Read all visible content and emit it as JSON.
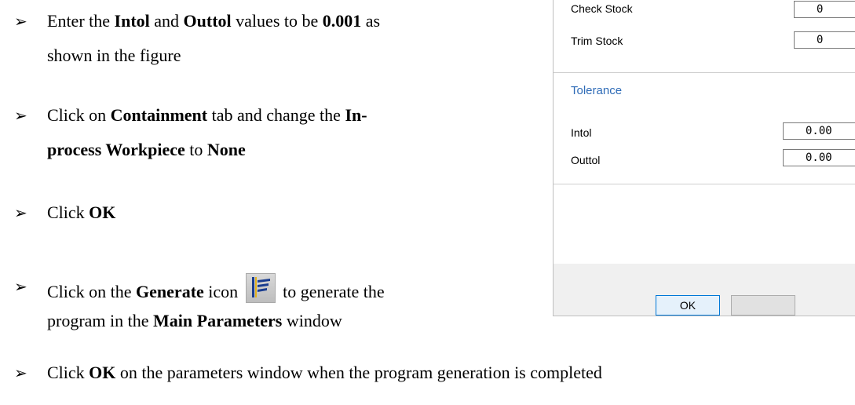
{
  "bullet_glyph": "➢",
  "bullets": [
    {
      "lines": [
        [
          {
            "t": "Enter the "
          },
          {
            "t": "Intol",
            "b": true
          },
          {
            "t": " and "
          },
          {
            "t": "Outtol",
            "b": true
          },
          {
            "t": " values to be "
          },
          {
            "t": "0.001",
            "b": true
          },
          {
            "t": " as"
          }
        ],
        [
          {
            "t": "shown in the figure"
          }
        ]
      ]
    },
    {
      "lines": [
        [
          {
            "t": "Click on "
          },
          {
            "t": "Containment",
            "b": true
          },
          {
            "t": " tab and change the "
          },
          {
            "t": "In-",
            "b": true
          }
        ],
        [
          {
            "t": "process Workpiece",
            "b": true
          },
          {
            "t": " to "
          },
          {
            "t": "None",
            "b": true
          }
        ]
      ]
    },
    {
      "lines": [
        [
          {
            "t": "Click "
          },
          {
            "t": "OK",
            "b": true
          }
        ]
      ]
    },
    {
      "lines": [
        [
          {
            "t": "Click on the "
          },
          {
            "t": "Generate",
            "b": true
          },
          {
            "t": " icon "
          },
          {
            "icon": "generate-icon"
          },
          {
            "t": " to generate the"
          }
        ],
        [
          {
            "t": "program in the "
          },
          {
            "t": "Main Parameters",
            "b": true
          },
          {
            "t": " window"
          }
        ]
      ]
    },
    {
      "lines": [
        [
          {
            "t": "Click "
          },
          {
            "t": "OK",
            "b": true
          },
          {
            "t": " on the parameters window when the program generation is completed"
          }
        ]
      ]
    }
  ],
  "dialog": {
    "check_stock_label": "Check Stock",
    "check_stock_value": "0",
    "trim_stock_label": "Trim Stock",
    "trim_stock_value": "0",
    "tolerance_section": "Tolerance",
    "intol_label": "Intol",
    "intol_value": "0.00",
    "outtol_label": "Outtol",
    "outtol_value": "0.00",
    "ok_label": "OK"
  },
  "colors": {
    "section_title": "#2e6bb7",
    "ok_border": "#0078d7",
    "ok_fill": "#e5f1fb",
    "dialog_footer": "#f0f0f0"
  }
}
